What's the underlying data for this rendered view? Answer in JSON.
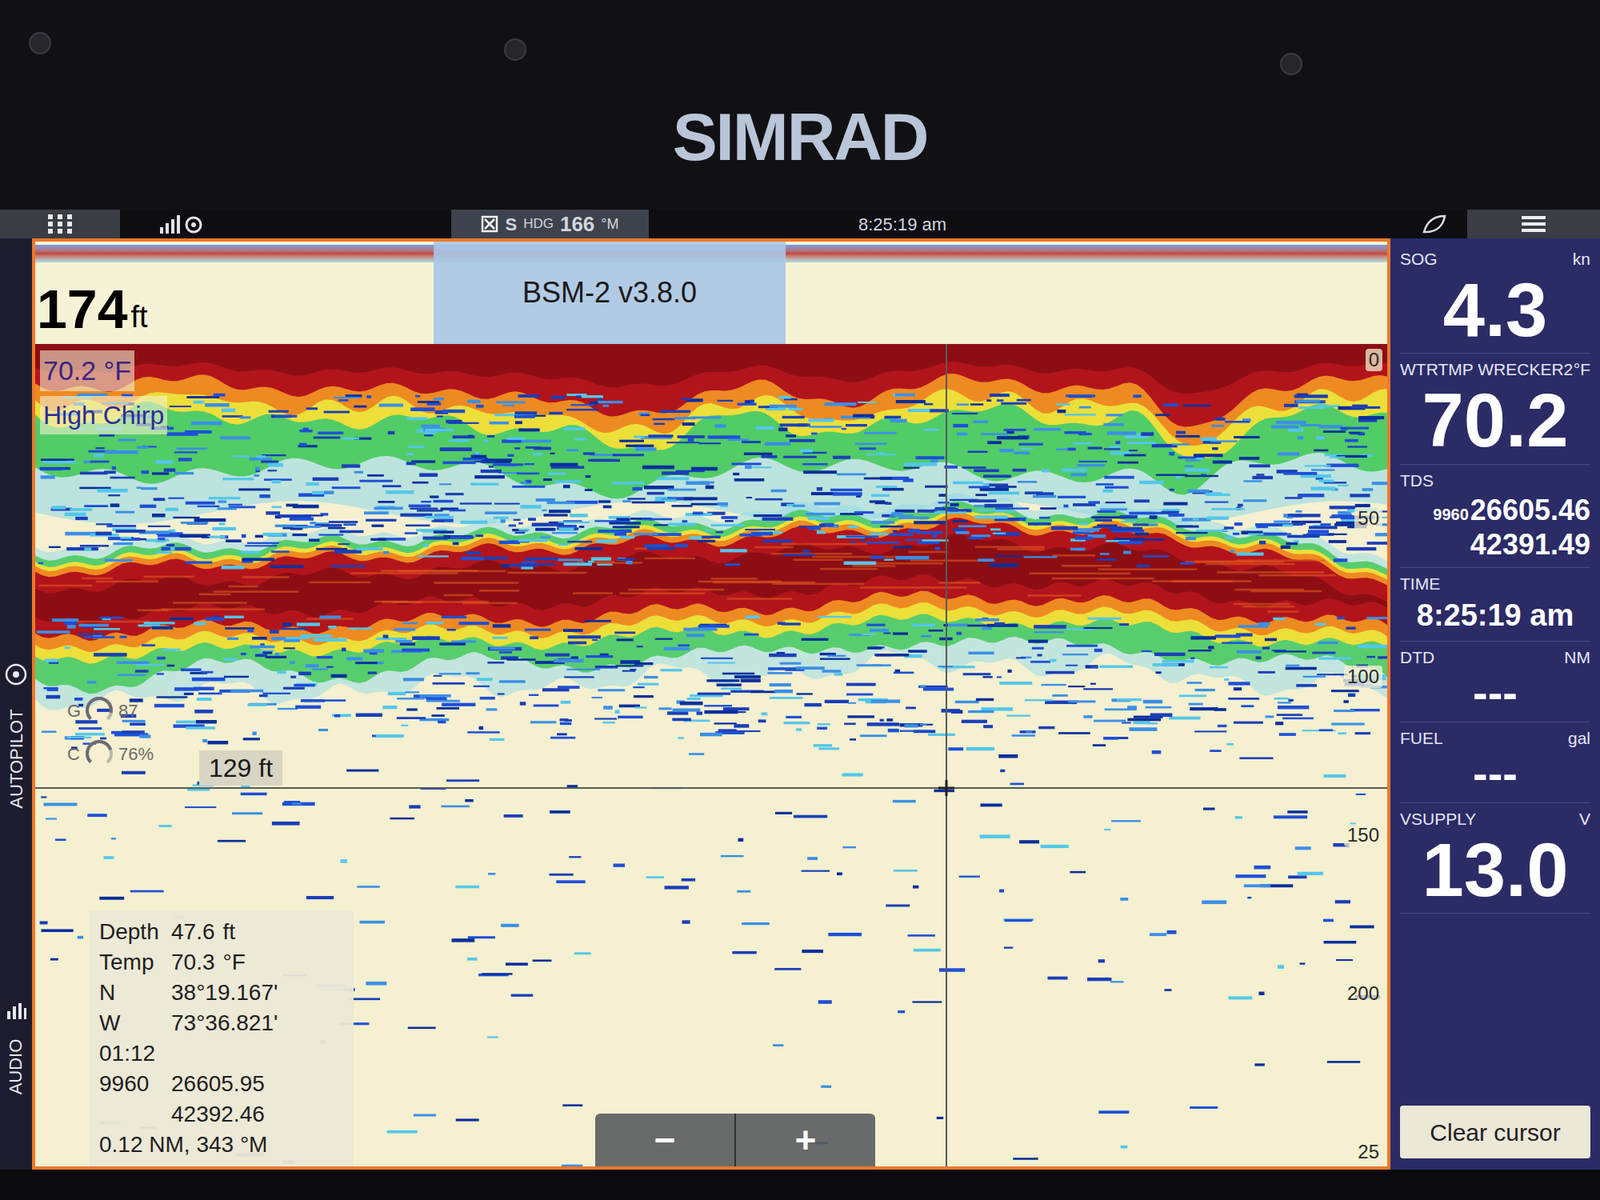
{
  "bezel": {
    "brand": "SIMRAD"
  },
  "status_bar": {
    "heading": {
      "source": "S",
      "label": "HDG",
      "value": "166",
      "unit": "°M"
    },
    "time": "8:25:19 am"
  },
  "side_tabs": [
    {
      "label": "AUTOPILOT"
    },
    {
      "label": "AUDIO"
    }
  ],
  "sonar": {
    "range": {
      "value": "174",
      "unit": "ft"
    },
    "version": "BSM-2 v3.8.0",
    "water_temp": "70.2 °F",
    "mode": "High Chirp",
    "scale": [
      "0",
      "50",
      "100",
      "150",
      "200",
      "25"
    ],
    "gain": {
      "label": "G",
      "value": "87",
      "level": 0.87
    },
    "contrast": {
      "label": "C",
      "value": "76%",
      "level": 0.76
    },
    "cursor_depth": "129 ft",
    "cursor_info": [
      {
        "kind": "pair",
        "label": "Depth",
        "value": "47.6",
        "unit": "ft"
      },
      {
        "kind": "pair",
        "label": "Temp",
        "value": "70.3",
        "unit": "°F"
      },
      {
        "kind": "pair",
        "label": "N",
        "value": "38°19.167'"
      },
      {
        "kind": "pair",
        "label": "W",
        "value": "73°36.821'"
      },
      {
        "kind": "line",
        "value": "01:12"
      },
      {
        "kind": "pair",
        "label": "9960",
        "value": "26605.95"
      },
      {
        "kind": "indent",
        "value": "42392.46"
      },
      {
        "kind": "line",
        "value": "0.12 NM, 343 °M"
      }
    ],
    "zoom": [
      "−",
      "+"
    ]
  },
  "data_bar": {
    "items": [
      {
        "label": "SOG",
        "unit": "kn",
        "kind": "big",
        "value": "4.3"
      },
      {
        "label": "WTRTMP WRECKER2",
        "unit": "°F",
        "kind": "big",
        "value": "70.2"
      },
      {
        "label": "TDS",
        "kind": "tds",
        "prefix": "9960",
        "value": "26605.46",
        "value2": "42391.49"
      },
      {
        "label": "TIME",
        "kind": "time",
        "value": "8:25:19 am"
      },
      {
        "label": "DTD",
        "unit": "NM",
        "kind": "dash",
        "value": "---"
      },
      {
        "label": "FUEL",
        "unit": "gal",
        "kind": "dash",
        "value": "---"
      },
      {
        "label": "VSUPPLY",
        "unit": "V",
        "kind": "big",
        "value": "13.0"
      }
    ],
    "clear_cursor": "Clear cursor"
  }
}
